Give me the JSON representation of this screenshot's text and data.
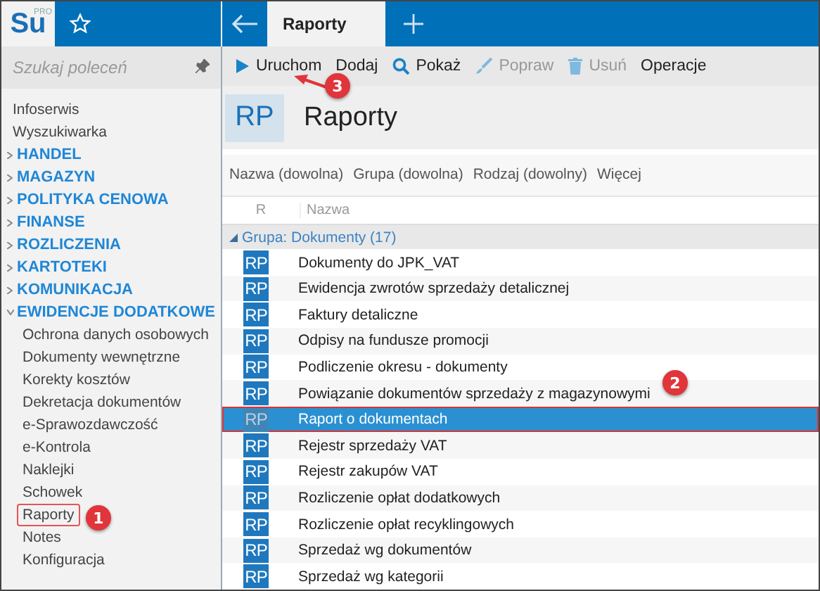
{
  "app": {
    "logo": "Su",
    "logo_badge": "PRO"
  },
  "tabs": [
    {
      "label": "Raporty",
      "selected": true
    }
  ],
  "sidebar": {
    "search": {
      "placeholder": "Szukaj poleceń"
    },
    "items": [
      {
        "label": "Infoserwis",
        "kind": "link",
        "marked": false
      },
      {
        "label": "Wyszukiwarka",
        "kind": "link",
        "marked": false
      },
      {
        "label": "HANDEL",
        "kind": "section",
        "expanded": false
      },
      {
        "label": "MAGAZYN",
        "kind": "section",
        "expanded": false
      },
      {
        "label": "POLITYKA CENOWA",
        "kind": "section",
        "expanded": false
      },
      {
        "label": "FINANSE",
        "kind": "section",
        "expanded": false
      },
      {
        "label": "ROZLICZENIA",
        "kind": "section",
        "expanded": false
      },
      {
        "label": "KARTOTEKI",
        "kind": "section",
        "expanded": false
      },
      {
        "label": "KOMUNIKACJA",
        "kind": "section",
        "expanded": false
      },
      {
        "label": "EWIDENCJE DODATKOWE",
        "kind": "section",
        "expanded": true,
        "children": [
          {
            "label": "Ochrona danych osobowych",
            "kind": "link",
            "marked": false
          },
          {
            "label": "Dokumenty wewnętrzne",
            "kind": "link",
            "marked": false
          },
          {
            "label": "Korekty kosztów",
            "kind": "link",
            "marked": false
          },
          {
            "label": "Dekretacja dokumentów",
            "kind": "link",
            "marked": false
          },
          {
            "label": "e-Sprawozdawczość",
            "kind": "link",
            "marked": false
          },
          {
            "label": "e-Kontrola",
            "kind": "link",
            "marked": false
          },
          {
            "label": "Naklejki",
            "kind": "link",
            "marked": false
          },
          {
            "label": "Schowek",
            "kind": "link",
            "marked": false
          },
          {
            "label": "Raporty",
            "kind": "link",
            "marked": true
          },
          {
            "label": "Notes",
            "kind": "link",
            "marked": false
          },
          {
            "label": "Konfiguracja",
            "kind": "link",
            "marked": false
          }
        ]
      }
    ]
  },
  "toolbar": [
    {
      "label": "Uruchom",
      "kind": "run",
      "disabled": false
    },
    {
      "label": "Dodaj",
      "kind": "plain",
      "disabled": false
    },
    {
      "label": "Pokaż",
      "kind": "search",
      "disabled": false
    },
    {
      "label": "Popraw",
      "kind": "edit",
      "disabled": true
    },
    {
      "label": "Usuń",
      "kind": "delete",
      "disabled": true
    },
    {
      "label": "Operacje",
      "kind": "plain",
      "disabled": false
    }
  ],
  "header": {
    "badge": "RP",
    "title": "Raporty"
  },
  "filters": [
    "Nazwa (dowolna)",
    "Grupa (dowolna)",
    "Rodzaj (dowolny)",
    "Więcej"
  ],
  "table": {
    "columns": [
      "R",
      "Nazwa"
    ],
    "group": {
      "label": "Grupa: Dokumenty (17)",
      "expanded": true
    },
    "rows": [
      {
        "icon": "RP",
        "name": "Dokumenty do JPK_VAT",
        "selected": false,
        "marked": false
      },
      {
        "icon": "RP",
        "name": "Ewidencja zwrotów sprzedaży detalicznej",
        "selected": false,
        "marked": false
      },
      {
        "icon": "RP",
        "name": "Faktury detaliczne",
        "selected": false,
        "marked": false
      },
      {
        "icon": "RP",
        "name": "Odpisy na fundusze promocji",
        "selected": false,
        "marked": false
      },
      {
        "icon": "RP",
        "name": "Podliczenie okresu - dokumenty",
        "selected": false,
        "marked": false
      },
      {
        "icon": "RP",
        "name": "Powiązanie dokumentów sprzedaży z magazynowymi",
        "selected": false,
        "marked": false
      },
      {
        "icon": "RP",
        "name": "Raport o dokumentach",
        "selected": true,
        "marked": true
      },
      {
        "icon": "RP",
        "name": "Rejestr sprzedaży VAT",
        "selected": false,
        "marked": false
      },
      {
        "icon": "RP",
        "name": "Rejestr zakupów VAT",
        "selected": false,
        "marked": false
      },
      {
        "icon": "RP",
        "name": "Rozliczenie opłat dodatkowych",
        "selected": false,
        "marked": false
      },
      {
        "icon": "RP",
        "name": "Rozliczenie opłat recyklingowych",
        "selected": false,
        "marked": false
      },
      {
        "icon": "RP",
        "name": "Sprzedaż wg dokumentów",
        "selected": false,
        "marked": false
      },
      {
        "icon": "RP",
        "name": "Sprzedaż wg kategorii",
        "selected": false,
        "marked": false
      }
    ]
  },
  "callouts": [
    {
      "label": "1"
    },
    {
      "label": "2"
    },
    {
      "label": "3"
    }
  ]
}
